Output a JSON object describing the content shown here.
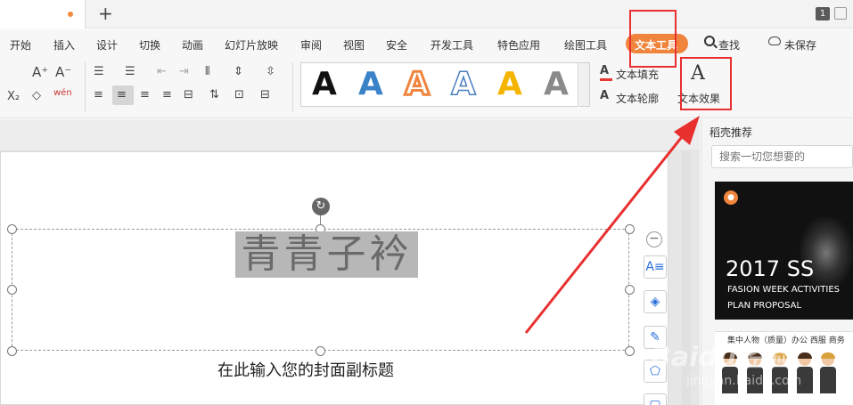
{
  "titlebar": {
    "new_tab": "+",
    "window_badge": "1"
  },
  "menu": {
    "items": [
      "开始",
      "插入",
      "设计",
      "切换",
      "动画",
      "幻灯片放映",
      "审阅",
      "视图",
      "安全",
      "开发工具",
      "特色应用",
      "绘图工具",
      "文本工具"
    ],
    "active": "文本工具",
    "search": "查找",
    "unsaved": "未保存"
  },
  "ribbon": {
    "text_fill": "文本填充",
    "text_outline": "文本轮廓",
    "text_effect": "文本效果",
    "effect_glyph": "A",
    "gallery_letter": "A",
    "gallery_colors": [
      "#111111",
      "#3a82c8",
      "#f0843c",
      "#4b7fbf",
      "#f4b400",
      "#8a8a8a"
    ],
    "font_grow": "A⁺",
    "font_shrink": "A⁻",
    "subscript": "X₂",
    "phonetic": "wén"
  },
  "slide": {
    "title": "青青子衿",
    "subtitle": "在此输入您的封面副标题"
  },
  "panel": {
    "title": "稻壳推荐",
    "search_placeholder": "搜索一切您想要的",
    "card1_year": "2017 SS",
    "card1_line1": "FASION WEEK ACTIVITIES",
    "card1_line2": "PLAN PROPOSAL",
    "card2_title": "集中人物（质量）办公 西服 商务"
  },
  "colors": {
    "accent": "#f0843c",
    "annotation": "#e83030"
  },
  "watermark": {
    "main": "Baidu经验",
    "sub": "jingyan.baidu.com"
  }
}
